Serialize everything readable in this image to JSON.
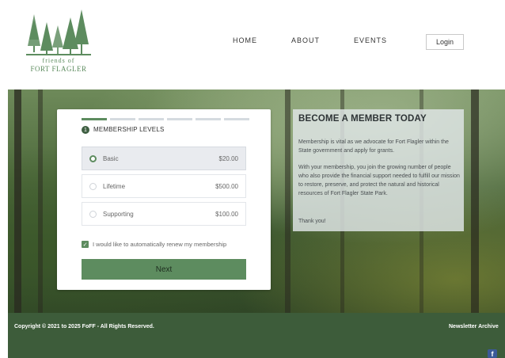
{
  "brand": {
    "logo_line1": "friends of",
    "logo_line2": "FORT FLAGLER"
  },
  "nav": {
    "home": "HOME",
    "about": "ABOUT",
    "events": "EVENTS",
    "login": "Login"
  },
  "membership": {
    "progress_steps": 6,
    "current_step": 1,
    "step_number": "1",
    "title": "MEMBERSHIP LEVELS",
    "options": [
      {
        "label": "Basic",
        "price": "$20.00",
        "selected": true
      },
      {
        "label": "Lifetime",
        "price": "$500.00",
        "selected": false
      },
      {
        "label": "Supporting",
        "price": "$100.00",
        "selected": false
      }
    ],
    "auto_renew_label": "I would like to automatically renew my membership",
    "auto_renew_checked": true,
    "next_label": "Next"
  },
  "info": {
    "title": "BECOME A MEMBER TODAY",
    "paragraph1": "Membership is vital as we advocate for Fort Flagler within the State government and apply for grants.",
    "paragraph2": "With your membership, you join the growing number of people who also provide the financial support needed to fulfill our mission to restore, preserve, and protect the natural and historical resources of Fort Flagler State Park.",
    "paragraph3": "Thank you!"
  },
  "footer": {
    "copyright": "Copyright © 2021 to 2025   FoFF - All Rights Reserved.",
    "newsletter": "Newsletter Archive",
    "facebook_icon": "f"
  },
  "colors": {
    "accent_green": "#5d8c5f",
    "footer_green": "#3d5c3a"
  }
}
